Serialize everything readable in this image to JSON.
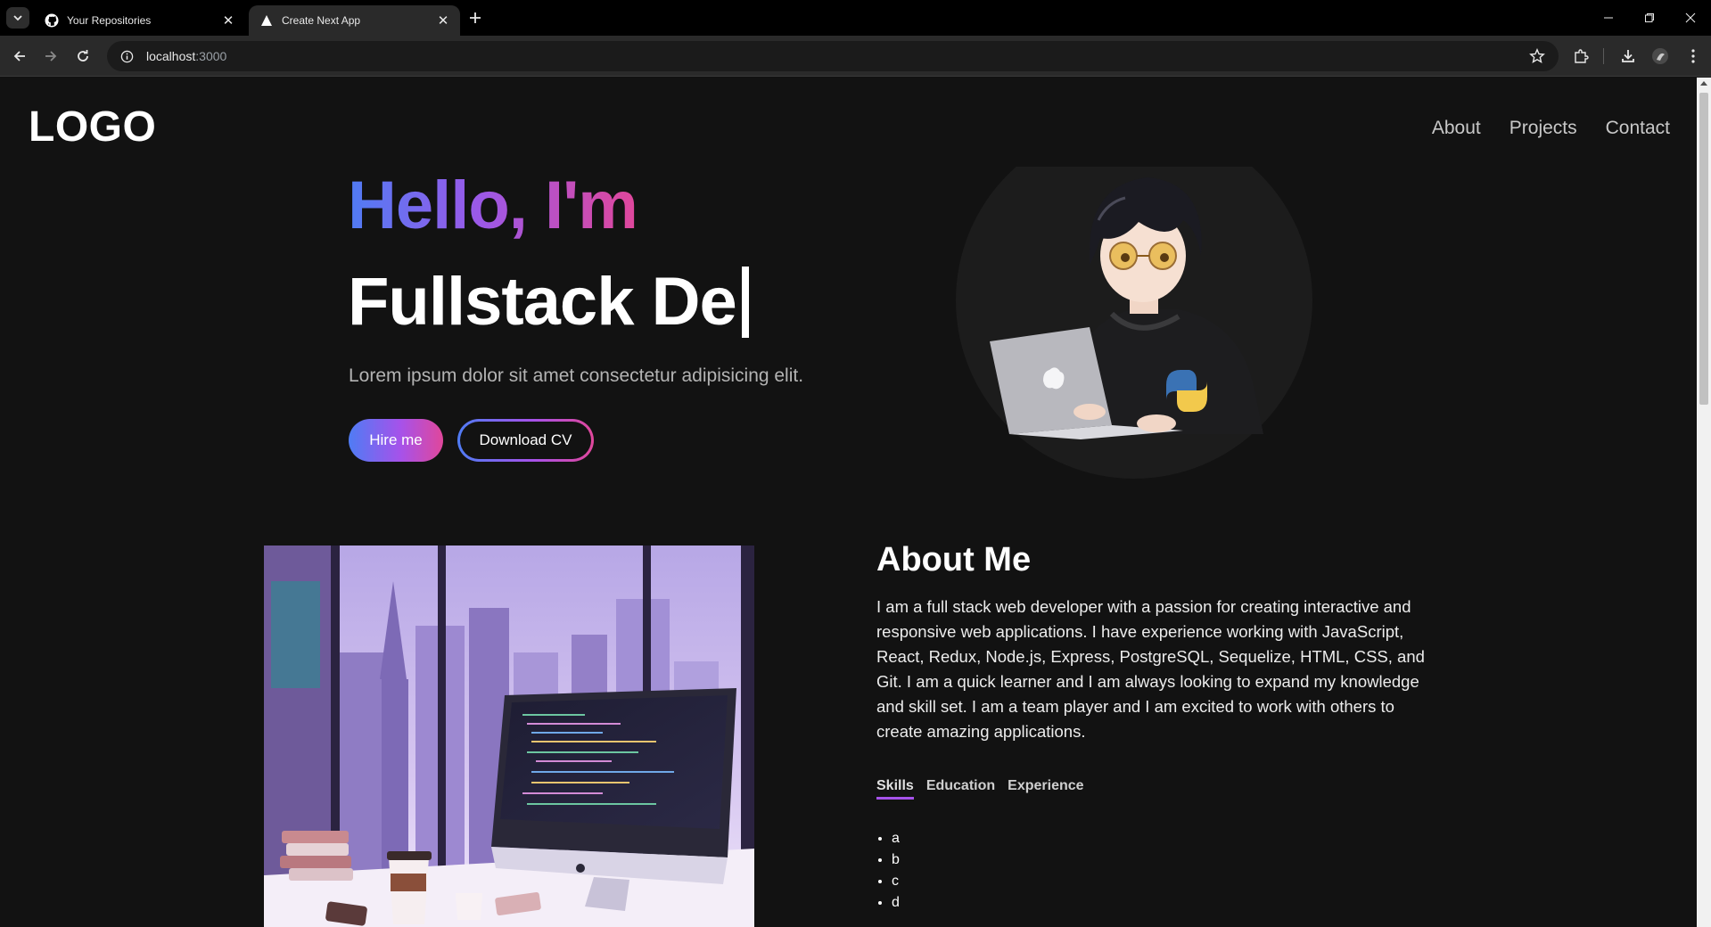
{
  "browser": {
    "tabs": [
      {
        "title": "Your Repositories",
        "icon": "github-icon",
        "active": false
      },
      {
        "title": "Create Next App",
        "icon": "nextjs-icon",
        "active": true
      }
    ],
    "address": {
      "host": "localhost",
      "port": ":3000"
    }
  },
  "header": {
    "logo": "LOGO",
    "nav": [
      {
        "label": "About"
      },
      {
        "label": "Projects"
      },
      {
        "label": "Contact"
      }
    ]
  },
  "hero": {
    "greeting": "Hello, I'm",
    "role_typed": "Fullstack De",
    "subtitle": "Lorem ipsum dolor sit amet consectetur adipisicing elit.",
    "hire_button": "Hire me",
    "cv_button": "Download CV",
    "gradient": [
      "#4f7cf4",
      "#a652ea",
      "#e0479b"
    ]
  },
  "about": {
    "title": "About Me",
    "text": "I am a full stack web developer with a passion for creating interactive and responsive web applications. I have experience working with JavaScript, React, Redux, Node.js, Express, PostgreSQL, Sequelize, HTML, CSS, and Git. I am a quick learner and I am always looking to expand my knowledge and skill set. I am a team player and I am excited to work with others to create amazing applications.",
    "tabs": [
      {
        "label": "Skills",
        "active": true
      },
      {
        "label": "Education",
        "active": false
      },
      {
        "label": "Experience",
        "active": false
      }
    ],
    "skills": [
      "a",
      "b",
      "c",
      "d"
    ]
  }
}
